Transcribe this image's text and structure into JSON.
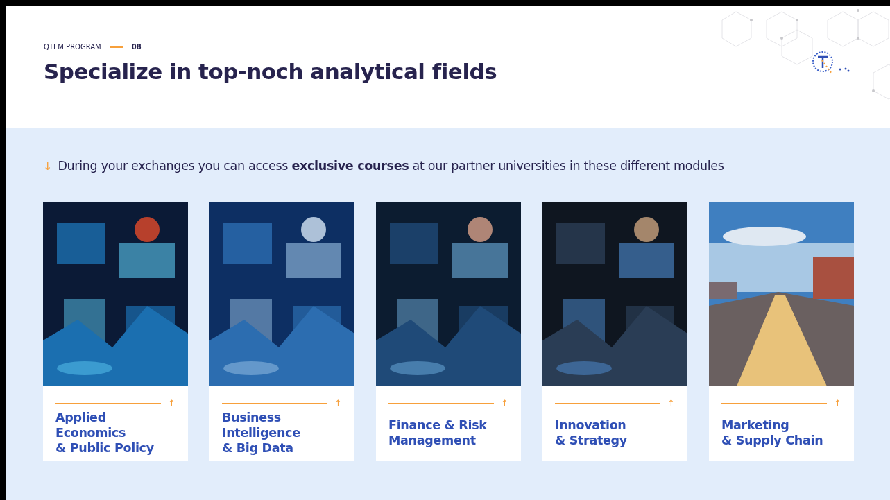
{
  "header": {
    "eyebrow": "QTEM PROGRAM",
    "number": "08",
    "title": "Specialize in top-noch analytical fields"
  },
  "intro": {
    "arrow": "↓",
    "text": "During your exchanges you can access **exclusive courses** at our partner universities in these different modules"
  },
  "modules": [
    {
      "title": "Applied\nEconomics\n& Public Policy",
      "arrow": "↑"
    },
    {
      "title": "Business\nIntelligence\n& Big Data",
      "arrow": "↑"
    },
    {
      "title": "Finance & Risk\nManagement",
      "arrow": "↑"
    },
    {
      "title": "Innovation\n& Strategy",
      "arrow": "↑"
    },
    {
      "title": "Marketing\n& Supply Chain",
      "arrow": "↑"
    }
  ]
}
